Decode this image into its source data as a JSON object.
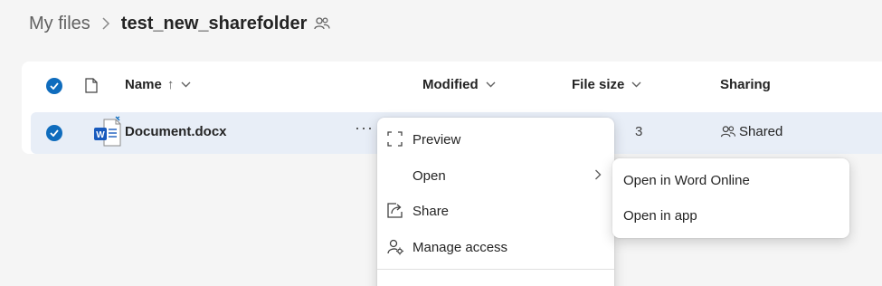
{
  "breadcrumb": {
    "parent": "My files",
    "current": "test_new_sharefolder",
    "shared_icon": "people-icon"
  },
  "columns": {
    "name": "Name",
    "name_sort": "↑",
    "modified": "Modified",
    "file_size": "File size",
    "sharing": "Sharing"
  },
  "rows": [
    {
      "name": "Document.docx",
      "type_icon": "word-document-icon",
      "more": "···",
      "partial_value": "3",
      "sharing": "Shared",
      "selected": true
    }
  ],
  "context_menu": {
    "items": [
      {
        "label": "Preview",
        "icon": "preview-icon"
      },
      {
        "label": "Open",
        "icon": "",
        "has_submenu": true
      },
      {
        "label": "Share",
        "icon": "share-icon"
      },
      {
        "label": "Manage access",
        "icon": "manage-access-icon"
      }
    ]
  },
  "open_submenu": {
    "items": [
      {
        "label": "Open in Word Online"
      },
      {
        "label": "Open in app"
      }
    ]
  },
  "colors": {
    "accent": "#0f6cbd",
    "selected_row": "#e8eef7",
    "word_blue": "#185abd"
  }
}
